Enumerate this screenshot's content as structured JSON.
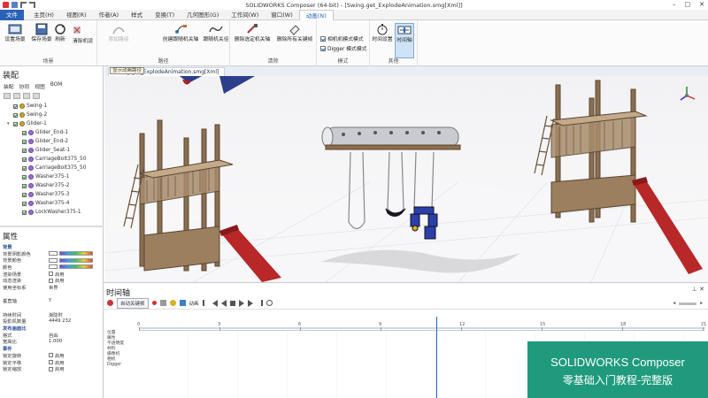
{
  "window": {
    "title": "SOLIDWORKS Composer (64-bit) - [Swing.get_ExplodeAnimation.smg[Xml]]"
  },
  "ribbon_tabs": [
    "文件",
    "主页(H)",
    "视图(R)",
    "作者(A)",
    "样式",
    "变换(T)",
    "几何图形(G)",
    "工作间(W)",
    "窗口(W)",
    "动画(N)"
  ],
  "ribbon_active_tab": "动画(N)",
  "ribbon": {
    "groups": {
      "scene": {
        "label": "场景",
        "buttons": [
          "设置场景",
          "保存场景",
          "刷新",
          "清除机设"
        ]
      },
      "path": {
        "label": "路径",
        "buttons": [
          "添加路径",
          "创建跟随机关轴",
          "跟随机关径"
        ]
      },
      "clear": {
        "label": "清除",
        "buttons": [
          "删除选定机关轴",
          "删除所有关键帧"
        ]
      },
      "mode": {
        "label": "模式",
        "options": [
          {
            "label": "相机机模式模式",
            "checked": true
          },
          {
            "label": "Digger 模式模式",
            "checked": true
          }
        ]
      },
      "other": {
        "label": "其他",
        "buttons": [
          "时间设置",
          "时间轴"
        ]
      }
    }
  },
  "doc_tab": "Swing.get_ExplodeAnimation.smg[Xml]",
  "tooltip": "显示动画路径",
  "assembly": {
    "title": "装配",
    "tabs": [
      "装配",
      "协同",
      "视图",
      "BOM"
    ],
    "items": [
      {
        "label": "Swing-1",
        "checked": true,
        "purple": false
      },
      {
        "label": "Swing-2",
        "checked": true,
        "purple": false
      },
      {
        "label": "Glider-1",
        "checked": true,
        "purple": false
      },
      {
        "label": "Glider_End-1",
        "checked": true,
        "purple": true
      },
      {
        "label": "Glider_End-2",
        "checked": true,
        "purple": true
      },
      {
        "label": "Glider_Seat-1",
        "checked": true,
        "purple": true
      },
      {
        "label": "CarriageBolt375_50",
        "checked": true,
        "purple": true
      },
      {
        "label": "CarriageBolt375_50",
        "checked": true,
        "purple": true
      },
      {
        "label": "Washer375-1",
        "checked": true,
        "purple": true
      },
      {
        "label": "Washer375-2",
        "checked": true,
        "purple": true
      },
      {
        "label": "Washer375-3",
        "checked": true,
        "purple": true
      },
      {
        "label": "Washer375-4",
        "checked": true,
        "purple": true
      },
      {
        "label": "LockWasher375-1",
        "checked": true,
        "purple": true
      }
    ]
  },
  "properties": {
    "title": "属性",
    "rows": [
      {
        "k": "背景",
        "v": "",
        "type": "sec"
      },
      {
        "k": "背景阴影颜色",
        "v": "",
        "type": "grad"
      },
      {
        "k": "背景颜色",
        "v": "",
        "type": "grad"
      },
      {
        "k": "颜色",
        "v": "",
        "type": "grad"
      },
      {
        "k": "渲染场景",
        "v": "启用",
        "type": "chk"
      },
      {
        "k": "动态渲染",
        "v": "启用",
        "type": "chk"
      },
      {
        "k": "使用坐标系",
        "v": "世界",
        "type": "text"
      },
      {
        "k": "",
        "v": "",
        "type": "text"
      },
      {
        "k": "垂直轴",
        "v": "Y",
        "type": "text"
      },
      {
        "k": "",
        "v": "",
        "type": "text"
      },
      {
        "k": "持续时间",
        "v": "渐隐时",
        "type": "text"
      },
      {
        "k": "投影机数量",
        "v": "4449  232",
        "type": "text"
      },
      {
        "k": "发布画面比",
        "v": "",
        "type": "sec"
      },
      {
        "k": "格式",
        "v": "自由",
        "type": "text"
      },
      {
        "k": "宽高比",
        "v": "1.000",
        "type": "text"
      },
      {
        "k": "事件",
        "v": "",
        "type": "sec"
      },
      {
        "k": "锁定旋转",
        "v": "启用",
        "type": "chk"
      },
      {
        "k": "锁定平移",
        "v": "启用",
        "type": "chk"
      },
      {
        "k": "锁定缩放",
        "v": "启用",
        "type": "chk"
      }
    ]
  },
  "timeline": {
    "title": "时间轴",
    "play_button": "自动关键帧",
    "tool_label": "动画",
    "ticks": [
      "0",
      "3",
      "6",
      "9",
      "12",
      "15",
      "18",
      "21"
    ],
    "tracks": [
      "位置",
      "属性",
      "不透明度",
      "材料",
      "摄像机",
      "相机",
      "Digger"
    ]
  },
  "banner": {
    "line1": "SOLIDWORKS Composer",
    "line2": "零基础入门教程-完整版"
  }
}
